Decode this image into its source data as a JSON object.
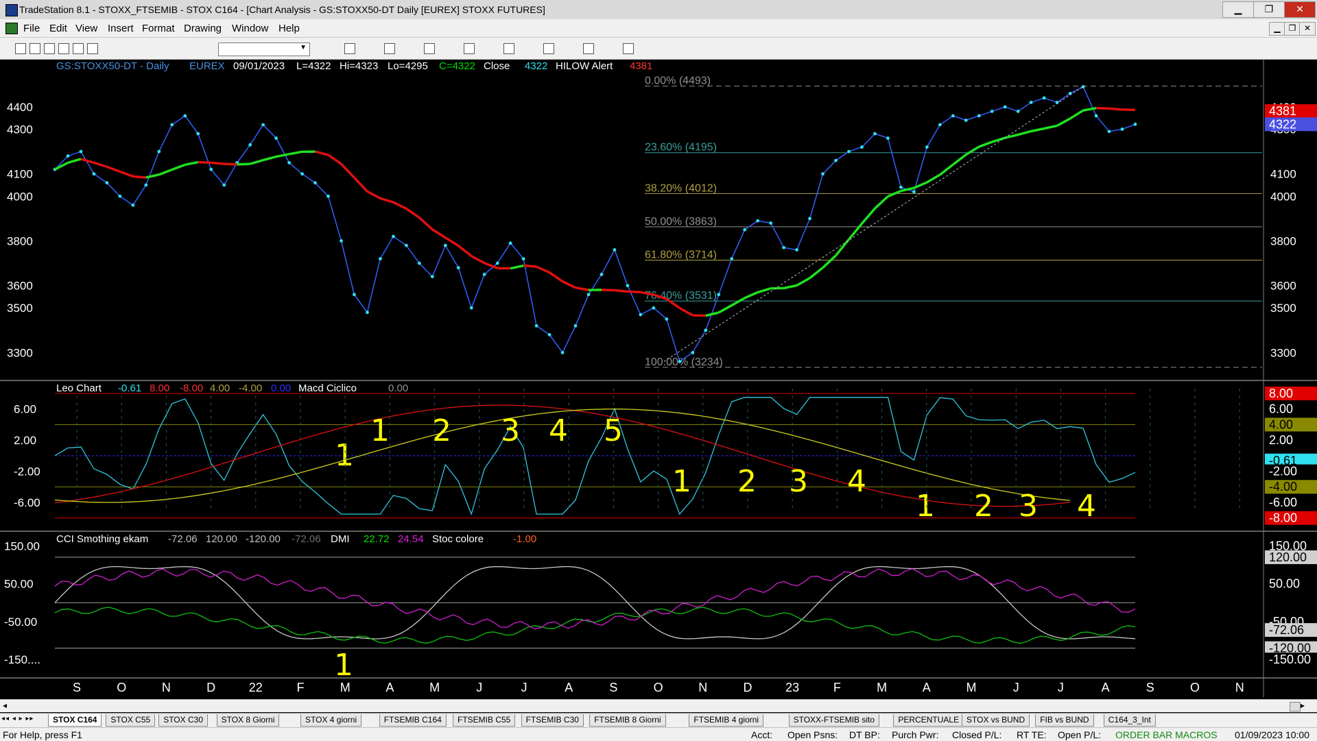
{
  "window": {
    "title": "TradeStation 8.1 - STOXX_FTSEMIB - STOX C164 - [Chart Analysis - GS:STOXX50-DT  Daily  [EUREX] STOXX FUTURES]",
    "btn_min": "▁",
    "btn_max": "❐",
    "btn_close": "✕"
  },
  "menu": [
    "File",
    "Edit",
    "View",
    "Insert",
    "Format",
    "Drawing",
    "Window",
    "Help"
  ],
  "mdi": [
    "▁",
    "❐",
    "✕"
  ],
  "toolbar_icons": [
    "new-icon",
    "open-icon",
    "save-icon",
    "print-icon",
    "chart-icon",
    "grid-icon",
    "cube-icon",
    "globe-icon",
    "zoom-in-icon",
    "zoom-out-icon",
    "cursor-icon",
    "trendline-icon",
    "fib-icon",
    "text-icon"
  ],
  "header": {
    "symbol": "GS:STOXX50-DT - Daily",
    "exchange": "EUREX",
    "date": "09/01/2023",
    "last": "L=4322",
    "hi": "Hi=4323",
    "lo": "Lo=4295",
    "close": "C=4322",
    "close_lbl": "Close",
    "close_val": "4322",
    "alert": "HILOW Alert",
    "alert_val": "4381"
  },
  "fib": [
    {
      "label": "0.00% (4493)",
      "value": 4493,
      "color": "#909090"
    },
    {
      "label": "23.60% (4195)",
      "value": 4195,
      "color": "#3aa0a0"
    },
    {
      "label": "38.20% (4012)",
      "value": 4012,
      "color": "#b0a040"
    },
    {
      "label": "50.00% (3863)",
      "value": 3863,
      "color": "#909090"
    },
    {
      "label": "61.80% (3714)",
      "value": 3714,
      "color": "#b0a040"
    },
    {
      "label": "76.40% (3531)",
      "value": 3531,
      "color": "#3aa0a0"
    },
    {
      "label": "100.00% (3234)",
      "value": 3234,
      "color": "#909090"
    }
  ],
  "price_axis": {
    "ticks": [
      "4400",
      "4300",
      "4100",
      "4000",
      "3800",
      "3600",
      "3500",
      "3300"
    ],
    "tick_values": [
      4400,
      4300,
      4100,
      4000,
      3800,
      3600,
      3500,
      3300
    ],
    "ylim": [
      3200,
      4550
    ],
    "red_badge": "4381",
    "blue_badge": "4322"
  },
  "sub1": {
    "title": "Leo Chart",
    "v1": "-0.61",
    "v2": "8.00",
    "v3": "-8.00",
    "v4": "4.00",
    "v5": "-4.00",
    "v6": "0.00",
    "name2": "Macd Ciclico",
    "v7": "0.00",
    "ticks": [
      "6.00",
      "2.00",
      "-2.00",
      "-6.00"
    ],
    "tick_values": [
      6,
      2,
      -2,
      -6
    ],
    "ylim": [
      -9,
      9.5
    ],
    "badges": [
      {
        "t": "8.00",
        "v": 8,
        "bg": "#e00000",
        "fg": "#fff"
      },
      {
        "t": "6.00",
        "v": 6,
        "bg": "#000",
        "fg": "#fff"
      },
      {
        "t": "4.00",
        "v": 4,
        "bg": "#8a8a00",
        "fg": "#000"
      },
      {
        "t": "2.00",
        "v": 2,
        "bg": "#000",
        "fg": "#fff"
      },
      {
        "t": "-0.61",
        "v": -0.61,
        "bg": "#30e0f0",
        "fg": "#000"
      },
      {
        "t": "-2.00",
        "v": -2,
        "bg": "#000",
        "fg": "#fff"
      },
      {
        "t": "-4.00",
        "v": -4,
        "bg": "#8a8a00",
        "fg": "#000"
      },
      {
        "t": "-6.00",
        "v": -6,
        "bg": "#000",
        "fg": "#fff"
      },
      {
        "t": "-8.00",
        "v": -8,
        "bg": "#e00000",
        "fg": "#fff"
      }
    ]
  },
  "sub2": {
    "title": "CCI Smothing ekam",
    "v1": "-72.06",
    "v2": "120.00",
    "v3": "-120.00",
    "v4": "-72.06",
    "dmi": "DMI",
    "d1": "22.72",
    "d2": "24.54",
    "stoc": "Stoc colore",
    "s1": "-1.00",
    "ticks": [
      "150.00",
      "50.00",
      "-50.00",
      "-150...."
    ],
    "tick_values": [
      150,
      50,
      -50,
      -150
    ],
    "ylim": [
      -195,
      185
    ],
    "badges": [
      {
        "t": "150.00",
        "v": 150,
        "bg": "#000",
        "fg": "#fff"
      },
      {
        "t": "120.00",
        "v": 120,
        "bg": "#d0d0d0",
        "fg": "#000"
      },
      {
        "t": "50.00",
        "v": 50,
        "bg": "#000",
        "fg": "#fff"
      },
      {
        "t": "-50.00",
        "v": -50,
        "bg": "#000",
        "fg": "#fff"
      },
      {
        "t": "-72.06",
        "v": -72.06,
        "bg": "#d0d0d0",
        "fg": "#000"
      },
      {
        "t": "-120.00",
        "v": -120,
        "bg": "#d0d0d0",
        "fg": "#000"
      },
      {
        "t": "-150.00",
        "v": -150,
        "bg": "#000",
        "fg": "#fff"
      }
    ]
  },
  "months": [
    "S",
    "O",
    "N",
    "D",
    "22",
    "F",
    "M",
    "A",
    "M",
    "J",
    "J",
    "A",
    "S",
    "O",
    "N",
    "D",
    "23",
    "F",
    "M",
    "A",
    "M",
    "J",
    "J",
    "A",
    "S",
    "O",
    "N"
  ],
  "annotations": {
    "row1": [
      "1",
      "2",
      "3",
      "4",
      "5"
    ],
    "row2": [
      "1",
      "2",
      "3",
      "4"
    ],
    "row3": [
      "1",
      "2",
      "3",
      "4"
    ],
    "mark_a": "1",
    "mark_b": "1"
  },
  "chart_data": {
    "type": "line",
    "title": "GS:STOXX50-DT - Daily",
    "series": [
      {
        "name": "",
        "values": [
          4120,
          4180,
          4200,
          4100,
          4060,
          4000,
          3960,
          4050,
          4200,
          4320,
          4360,
          4280,
          4120,
          4050,
          4150,
          4230,
          4320,
          4260,
          4150,
          4100,
          4060,
          4000,
          3800,
          3560,
          3480,
          3720,
          3820,
          3780,
          3700,
          3640,
          3780,
          3680,
          3500,
          3650,
          3700,
          3790,
          3720,
          3420,
          3380,
          3300,
          3420,
          3560,
          3650,
          3760,
          3600,
          3470,
          3500,
          3450,
          3260,
          3300,
          3400,
          3560,
          3720,
          3850,
          3890,
          3880,
          3770,
          3760,
          3900,
          4100,
          4160,
          4200,
          4220,
          4280,
          4260,
          4040,
          4020,
          4220,
          4320,
          4360,
          4340,
          4360,
          4380,
          4400,
          4380,
          4420,
          4440,
          4420,
          4460,
          4490,
          4360,
          4290,
          4300,
          4322
        ]
      }
    ],
    "ylabel": "",
    "ylim": [
      3200,
      4550
    ]
  },
  "tabs": [
    "STOX C164",
    "STOX C55",
    "STOX  C30",
    "STOX  8 Giorni",
    "STOX 4 giorni",
    "FTSEMIB C164",
    "FTSEMIB C55",
    "FTSEMIB C30",
    "FTSEMIB  8 Giorni",
    "FTSEMIB  4 giorni",
    "STOXX-FTSEMIB sito",
    "PERCENTUALE",
    "STOX vs BUND",
    "FIB vs BUND",
    "C164_3_Int"
  ],
  "tab_nav": "◂◂ ◂ ▸ ▸▸",
  "status": {
    "help": "For Help, press F1",
    "acct": "Acct:",
    "open_psns": "Open Psns:",
    "dt_bp": "DT BP:",
    "purch": "Purch Pwr:",
    "closed": "Closed P/L:",
    "rt_te": "RT TE:",
    "open_pl": "Open P/L:",
    "obm": "ORDER BAR  MACROS",
    "datetime": "01/09/2023 10:00"
  }
}
